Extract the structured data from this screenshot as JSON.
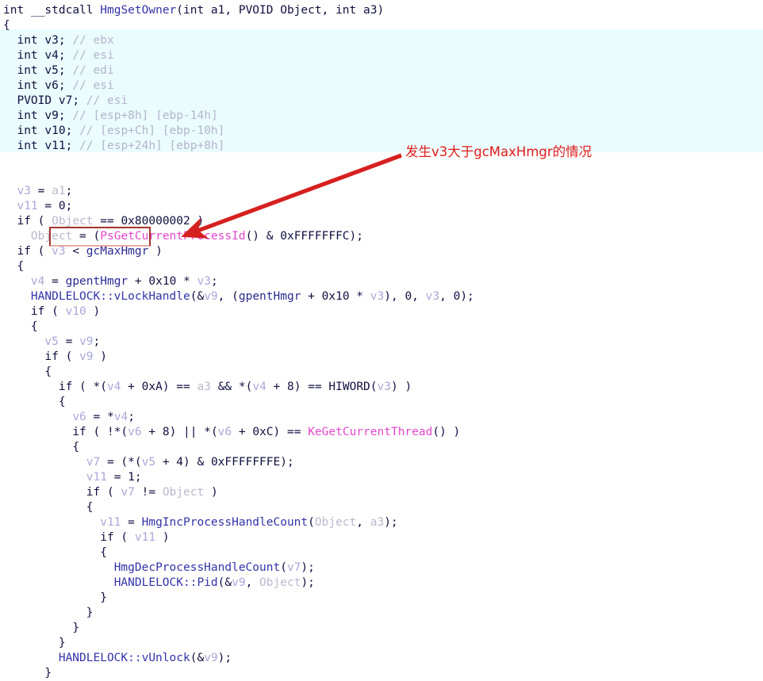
{
  "window": {
    "title": "int __stdcall HmgSetOwner(int a1, PVOID Object, int a3)"
  },
  "annotation": {
    "note": "发生v3大于gcMaxHmgr的情况",
    "note_color": "#e01b1b",
    "box_color": "#a4352b",
    "arrow_color": "#d62020",
    "highlighted_expression": "v3 < gcMaxHmgr"
  },
  "theme": {
    "background": "#ffffff",
    "declaration_band": "#eafcfd",
    "keyword": "#101040",
    "variable": "#a8a8d8",
    "argument": "#b9b9cf",
    "comment": "#b4b4cc",
    "function": "#3333aa",
    "api_call": "#e346cb",
    "global": "#2b2b8f"
  },
  "code": {
    "signature": {
      "ret": "int",
      "conv": "__stdcall",
      "name": "HmgSetOwner",
      "params": "(int a1, PVOID Object, int a3)"
    },
    "declarations": [
      {
        "type": "int",
        "name": "v3;",
        "comment": "// ebx"
      },
      {
        "type": "int",
        "name": "v4;",
        "comment": "// esi"
      },
      {
        "type": "int",
        "name": "v5;",
        "comment": "// edi"
      },
      {
        "type": "int",
        "name": "v6;",
        "comment": "// esi"
      },
      {
        "type": "PVOID",
        "name": "v7;",
        "comment": "// esi"
      },
      {
        "type": "int",
        "name": "v9;",
        "comment": "// [esp+8h] [ebp-14h]"
      },
      {
        "type": "int",
        "name": "v10;",
        "comment": "// [esp+Ch] [ebp-10h]"
      },
      {
        "type": "int",
        "name": "v11;",
        "comment": "// [esp+24h] [ebp+8h]"
      }
    ],
    "lines": [
      "v3 = a1;",
      "v11 = 0;",
      "if ( Object == 0x80000002 )",
      "  Object = (PsGetCurrentProcessId() & 0xFFFFFFFC);",
      "if ( v3 < gcMaxHmgr )",
      "{",
      "  v4 = gpentHmgr + 0x10 * v3;",
      "  HANDLELOCK::vLockHandle(&v9, (gpentHmgr + 0x10 * v3), 0, v3, 0);",
      "  if ( v10 )",
      "  {",
      "    v5 = v9;",
      "    if ( v9 )",
      "    {",
      "      if ( *(v4 + 0xA) == a3 && *(v4 + 8) == HIWORD(v3) )",
      "      {",
      "        v6 = *v4;",
      "        if ( !*(v6 + 8) || *(v6 + 0xC) == KeGetCurrentThread() )",
      "        {",
      "          v7 = (*(v5 + 4) & 0xFFFFFFFE);",
      "          v11 = 1;",
      "          if ( v7 != Object )",
      "          {",
      "            v11 = HmgIncProcessHandleCount(Object, a3);",
      "            if ( v11 )",
      "            {",
      "              HmgDecProcessHandleCount(v7);",
      "              HANDLELOCK::Pid(&v9, Object);",
      "            }",
      "          }",
      "        }",
      "      }",
      "      HANDLELOCK::vUnlock(&v9);",
      "    }"
    ],
    "open_brace": "{"
  }
}
